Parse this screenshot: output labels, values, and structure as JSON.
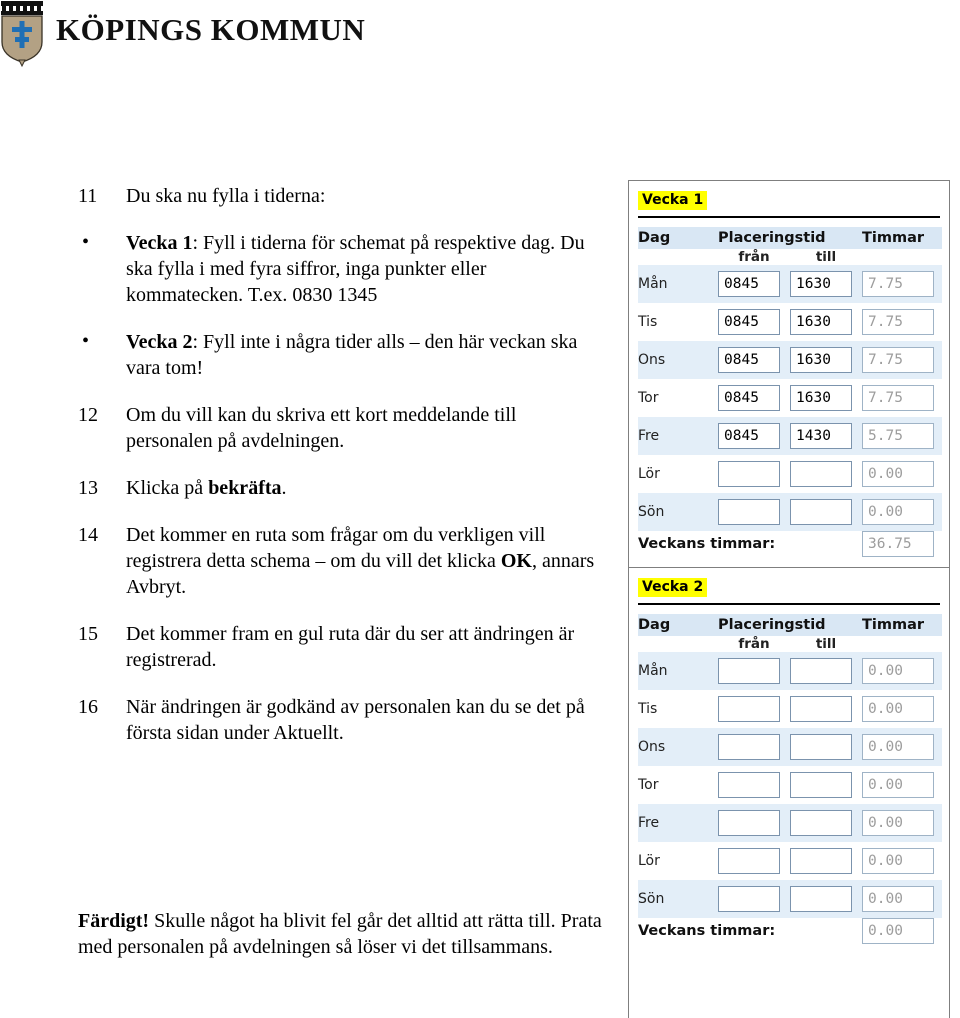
{
  "header": {
    "organization": "KÖPINGS KOMMUN",
    "logo_name": "koping-coat-of-arms",
    "shield_color": "#b3a184",
    "cross_color": "#1f6fb5"
  },
  "document": {
    "steps": [
      {
        "kind": "numbered",
        "number": "11",
        "runs": [
          {
            "text": "Du ska nu fylla i tiderna:",
            "bold": false
          }
        ]
      },
      {
        "kind": "bullet",
        "bullet": "•",
        "runs": [
          {
            "text": "Vecka 1",
            "bold": true
          },
          {
            "text": ": Fyll i tiderna för schemat på respektive dag. Du ska fylla i med fyra siffror, inga punkter eller kommatecken. T.ex. 0830 1345",
            "bold": false
          }
        ]
      },
      {
        "kind": "bullet",
        "bullet": "•",
        "runs": [
          {
            "text": "Vecka 2",
            "bold": true
          },
          {
            "text": ": Fyll inte i några tider alls – den här veckan ska vara tom!",
            "bold": false
          }
        ]
      },
      {
        "kind": "numbered",
        "number": "12",
        "runs": [
          {
            "text": "Om du vill kan du skriva ett kort meddelande till personalen på avdelningen.",
            "bold": false
          }
        ]
      },
      {
        "kind": "numbered",
        "number": "13",
        "runs": [
          {
            "text": "Klicka på ",
            "bold": false
          },
          {
            "text": "bekräfta",
            "bold": true
          },
          {
            "text": ".",
            "bold": false
          }
        ]
      },
      {
        "kind": "numbered",
        "number": "14",
        "runs": [
          {
            "text": "Det kommer en ruta som frågar om du verkligen vill registrera detta schema – om du vill det klicka ",
            "bold": false
          },
          {
            "text": "OK",
            "bold": true
          },
          {
            "text": ", annars Avbryt.",
            "bold": false
          }
        ]
      },
      {
        "kind": "numbered",
        "number": "15",
        "runs": [
          {
            "text": "Det kommer fram en gul ruta där du ser att ändringen är registrerad.",
            "bold": false
          }
        ]
      },
      {
        "kind": "numbered",
        "number": "16",
        "runs": [
          {
            "text": "När ändringen är godkänd av personalen kan du se det på första sidan under Aktuellt.",
            "bold": false
          }
        ]
      }
    ],
    "closing": [
      {
        "text": "Färdigt!",
        "bold": true
      },
      {
        "text": " Skulle något ha blivit fel går det alltid att rätta till. Prata med personalen på avdelningen så löser vi det tillsammans.",
        "bold": false
      }
    ]
  },
  "schedule_panel": {
    "highlight_color": "#ffff00",
    "header_bg": "#d9e7f4",
    "row_shade_bg": "#e3eef8",
    "readonly_text_color": "#9d9d9d",
    "columns": {
      "day": "Dag",
      "time_span": "Placeringstid",
      "hours": "Timmar",
      "from": "från",
      "to": "till"
    },
    "total_label": "Veckans timmar:",
    "weeks": [
      {
        "title": "Vecka 1",
        "rows": [
          {
            "day": "Mån",
            "from": "0845",
            "to": "1630",
            "hours": "7.75",
            "shaded": true
          },
          {
            "day": "Tis",
            "from": "0845",
            "to": "1630",
            "hours": "7.75",
            "shaded": false
          },
          {
            "day": "Ons",
            "from": "0845",
            "to": "1630",
            "hours": "7.75",
            "shaded": true
          },
          {
            "day": "Tor",
            "from": "0845",
            "to": "1630",
            "hours": "7.75",
            "shaded": false
          },
          {
            "day": "Fre",
            "from": "0845",
            "to": "1430",
            "hours": "5.75",
            "shaded": true
          },
          {
            "day": "Lör",
            "from": "",
            "to": "",
            "hours": "0.00",
            "shaded": false
          },
          {
            "day": "Sön",
            "from": "",
            "to": "",
            "hours": "0.00",
            "shaded": true
          }
        ],
        "total": "36.75"
      },
      {
        "title": "Vecka 2",
        "rows": [
          {
            "day": "Mån",
            "from": "",
            "to": "",
            "hours": "0.00",
            "shaded": true
          },
          {
            "day": "Tis",
            "from": "",
            "to": "",
            "hours": "0.00",
            "shaded": false
          },
          {
            "day": "Ons",
            "from": "",
            "to": "",
            "hours": "0.00",
            "shaded": true
          },
          {
            "day": "Tor",
            "from": "",
            "to": "",
            "hours": "0.00",
            "shaded": false
          },
          {
            "day": "Fre",
            "from": "",
            "to": "",
            "hours": "0.00",
            "shaded": true
          },
          {
            "day": "Lör",
            "from": "",
            "to": "",
            "hours": "0.00",
            "shaded": false
          },
          {
            "day": "Sön",
            "from": "",
            "to": "",
            "hours": "0.00",
            "shaded": true
          }
        ],
        "total": "0.00"
      }
    ]
  }
}
